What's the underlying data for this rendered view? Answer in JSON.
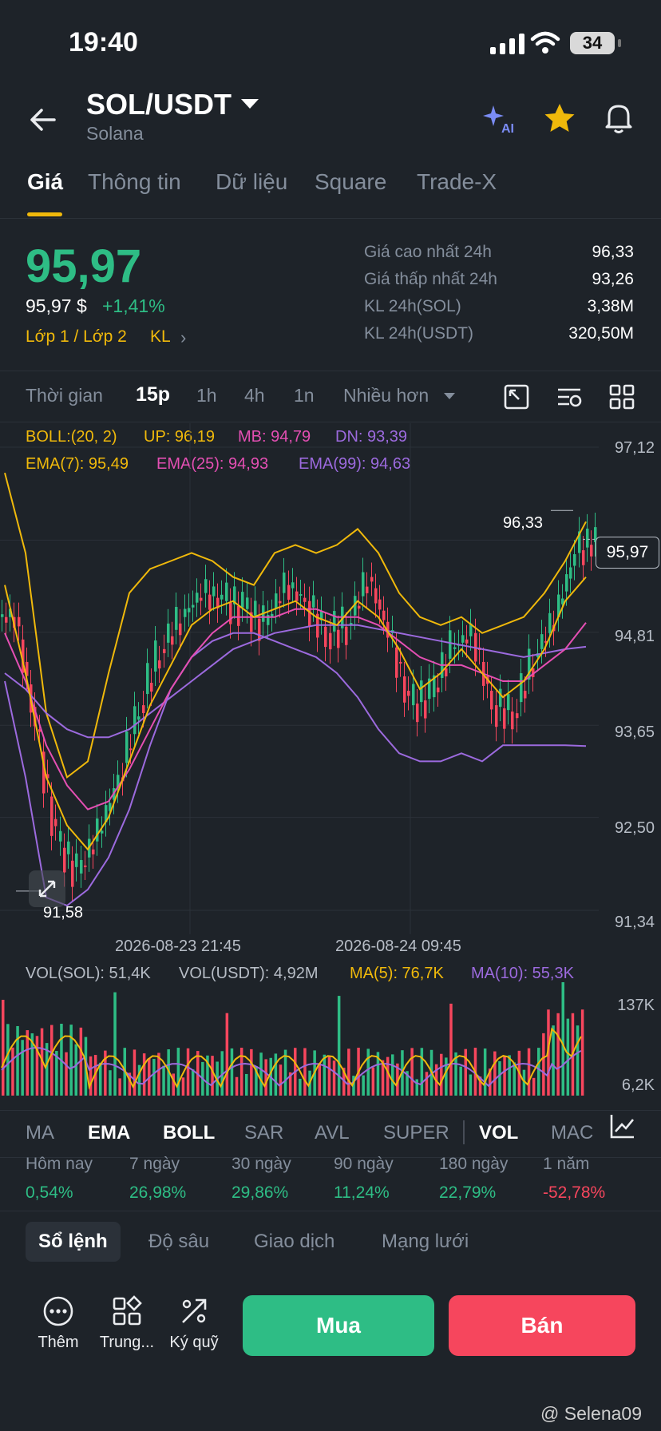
{
  "status_bar": {
    "time": "19:40",
    "battery": "34"
  },
  "header": {
    "pair": "SOL/USDT",
    "coin_name": "Solana"
  },
  "tabs": [
    "Giá",
    "Thông tin",
    "Dữ liệu",
    "Square",
    "Trade-X"
  ],
  "price": {
    "last": "95,97",
    "usd": "95,97 $",
    "change": "+1,41%",
    "layer_link": "Lớp 1 / Lớp 2",
    "kl_link": "KL"
  },
  "stats": [
    {
      "label": "Giá cao nhất 24h",
      "value": "96,33"
    },
    {
      "label": "Giá thấp nhất 24h",
      "value": "93,26"
    },
    {
      "label": "KL 24h(SOL)",
      "value": "3,38M"
    },
    {
      "label": "KL 24h(USDT)",
      "value": "320,50M"
    }
  ],
  "intervals": [
    "Thời gian",
    "15p",
    "1h",
    "4h",
    "1n",
    "Nhiều hơn"
  ],
  "indicators": {
    "boll": "BOLL:(20, 2)",
    "up": "UP: 96,19",
    "mb": "MB: 94,79",
    "dn": "DN: 93,39",
    "ema7": "EMA(7): 95,49",
    "ema25": "EMA(25): 94,93",
    "ema99": "EMA(99): 94,63"
  },
  "colors": {
    "up": "#2ebd85",
    "down": "#f6465d",
    "yellow": "#f0b90b",
    "pink": "#e44fb3",
    "purple": "#9c6ade",
    "bg": "#1e2329"
  },
  "chart_data": {
    "type": "candlestick",
    "y_axis_labels": [
      "97,12",
      "95,96",
      "94,81",
      "93,65",
      "92,50",
      "91,34"
    ],
    "ylim": [
      91.34,
      97.12
    ],
    "x_axis_labels": [
      "2026-08-23 21:45",
      "2026-08-24 09:45"
    ],
    "high_marker": "96,33",
    "low_marker": "91,58",
    "last_price_tag": "95,97",
    "ema7": [
      95.4,
      94.3,
      93.0,
      92.4,
      92.1,
      92.5,
      93.2,
      93.9,
      94.4,
      94.9,
      95.1,
      95.2,
      95.0,
      95.1,
      95.2,
      95.0,
      94.9,
      95.2,
      95.0,
      94.6,
      94.1,
      94.3,
      94.6,
      94.3,
      94.0,
      94.2,
      94.6,
      95.2,
      95.5
    ],
    "ema25": [
      94.8,
      94.2,
      93.4,
      92.9,
      92.6,
      92.7,
      93.1,
      93.6,
      94.1,
      94.5,
      94.8,
      95.0,
      95.0,
      95.0,
      95.1,
      95.1,
      95.0,
      95.0,
      94.9,
      94.7,
      94.5,
      94.4,
      94.4,
      94.3,
      94.2,
      94.2,
      94.4,
      94.6,
      94.93
    ],
    "ema99": [
      94.3,
      94.1,
      93.8,
      93.6,
      93.5,
      93.5,
      93.6,
      93.8,
      94.0,
      94.2,
      94.4,
      94.6,
      94.7,
      94.8,
      94.85,
      94.9,
      94.9,
      94.9,
      94.85,
      94.8,
      94.75,
      94.7,
      94.65,
      94.6,
      94.55,
      94.5,
      94.55,
      94.6,
      94.63
    ],
    "boll_up": [
      96.8,
      95.8,
      93.8,
      93.0,
      93.2,
      94.3,
      95.3,
      95.6,
      95.7,
      95.8,
      95.7,
      95.5,
      95.4,
      95.8,
      95.9,
      95.8,
      95.9,
      96.1,
      95.8,
      95.3,
      95.0,
      94.9,
      95.0,
      94.8,
      94.9,
      95.0,
      95.3,
      95.7,
      96.19
    ],
    "boll_dn": [
      94.2,
      93.0,
      91.5,
      91.4,
      91.6,
      92.0,
      92.6,
      93.4,
      94.1,
      94.5,
      94.7,
      94.8,
      94.8,
      94.7,
      94.6,
      94.5,
      94.3,
      94.0,
      93.6,
      93.3,
      93.2,
      93.2,
      93.3,
      93.2,
      93.4,
      93.4,
      93.4,
      93.4,
      93.39
    ],
    "candles_close": [
      95.0,
      93.6,
      92.2,
      91.8,
      92.3,
      93.0,
      93.9,
      94.6,
      95.0,
      95.3,
      95.2,
      95.1,
      94.9,
      95.4,
      95.2,
      94.8,
      94.9,
      95.5,
      94.8,
      93.9,
      94.0,
      94.6,
      94.8,
      93.9,
      93.8,
      94.5,
      95.0,
      95.8,
      95.97
    ]
  },
  "volume": {
    "legend": {
      "sol": "VOL(SOL): 51,4K",
      "usdt": "VOL(USDT): 4,92M",
      "ma5": "MA(5): 76,7K",
      "ma10": "MA(10): 55,3K"
    },
    "y_labels": [
      "137K",
      "6,2K"
    ]
  },
  "indicator_tabs": [
    "MA",
    "EMA",
    "BOLL",
    "SAR",
    "AVL",
    "SUPER",
    "VOL",
    "MAC"
  ],
  "performance": [
    {
      "label": "Hôm nay",
      "value": "0,54%",
      "dir": "up"
    },
    {
      "label": "7 ngày",
      "value": "26,98%",
      "dir": "up"
    },
    {
      "label": "30 ngày",
      "value": "29,86%",
      "dir": "up"
    },
    {
      "label": "90 ngày",
      "value": "11,24%",
      "dir": "up"
    },
    {
      "label": "180 ngày",
      "value": "22,79%",
      "dir": "up"
    },
    {
      "label": "1 năm",
      "value": "-52,78%",
      "dir": "down"
    }
  ],
  "book_tabs": [
    "Sổ lệnh",
    "Độ sâu",
    "Giao dịch",
    "Mạng lưới"
  ],
  "bottom": {
    "more": "Thêm",
    "hub": "Trung...",
    "margin": "Ký quỹ",
    "buy": "Mua",
    "sell": "Bán"
  },
  "watermark": "@ Selena09"
}
